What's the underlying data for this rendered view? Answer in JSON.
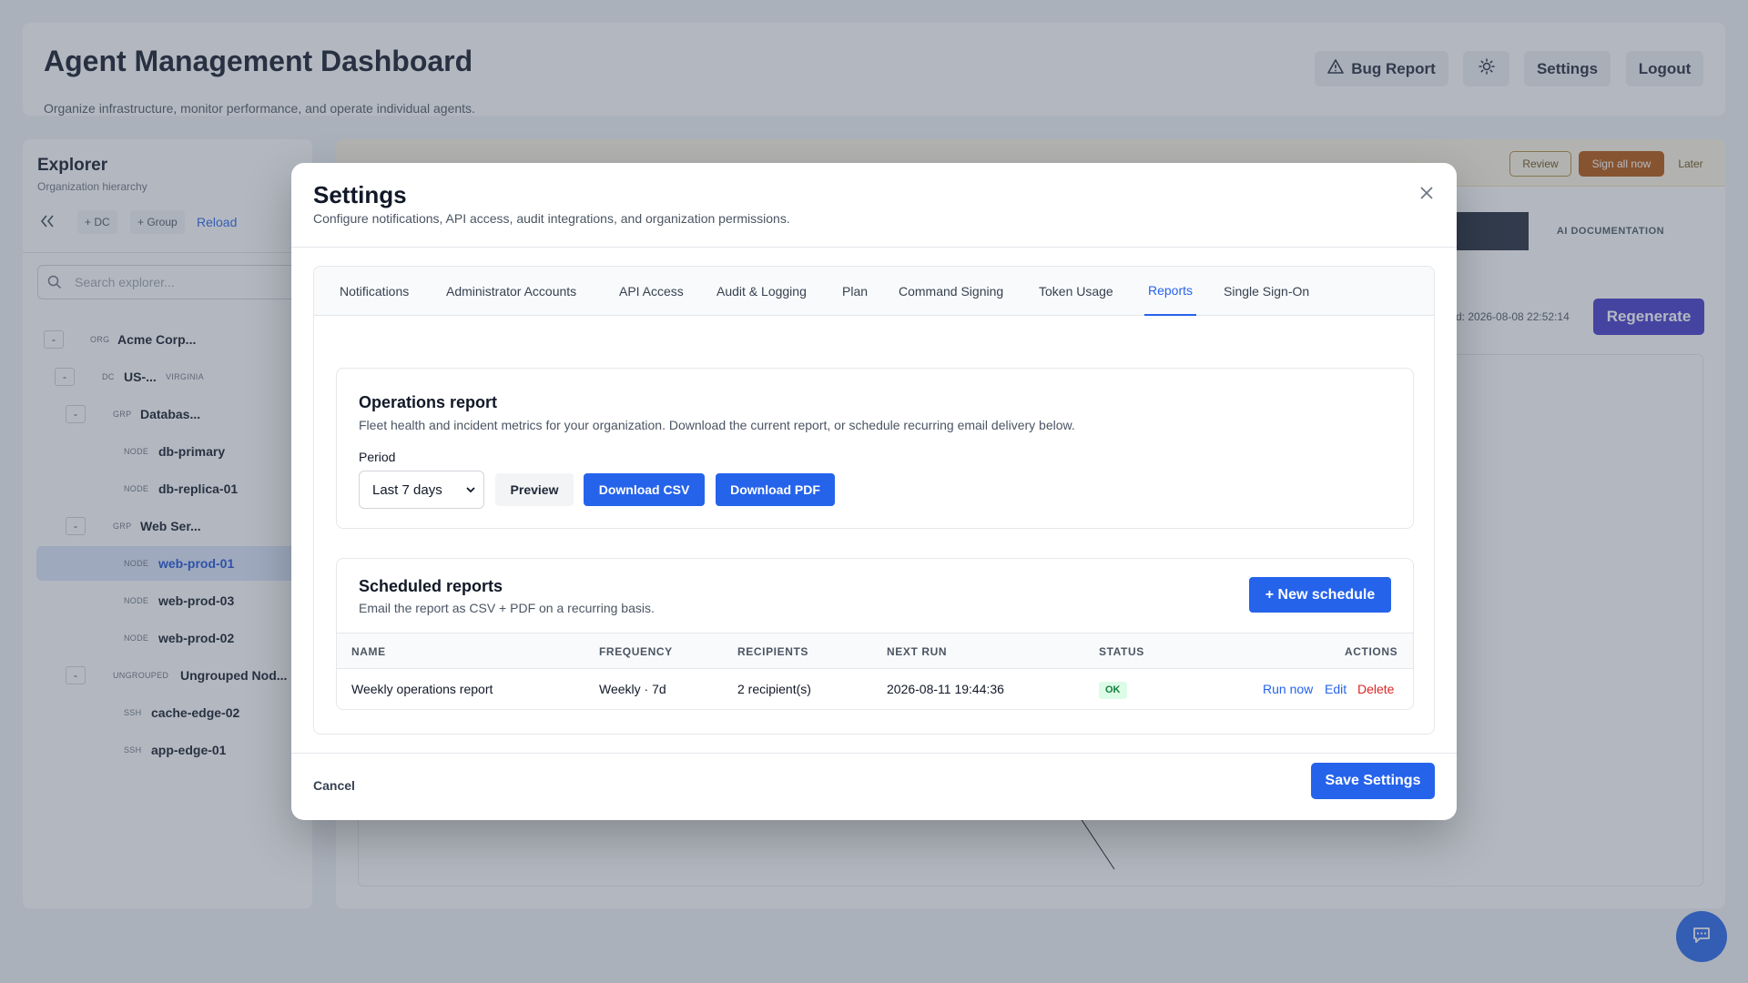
{
  "app": {
    "title": "Agent Management Dashboard",
    "subtitle": "Organize infrastructure, monitor performance, and operate individual agents.",
    "header_buttons": {
      "bug_report": "Bug Report",
      "settings": "Settings",
      "logout": "Logout"
    }
  },
  "explorer": {
    "title": "Explorer",
    "subtitle": "Organization hierarchy",
    "tools": {
      "add_dc": "+ DC",
      "add_group": "+ Group",
      "reload": "Reload"
    },
    "search_placeholder": "Search explorer...",
    "tree": [
      {
        "toggle": "-",
        "type": "ORG",
        "name": "Acme Corp..."
      },
      {
        "toggle": "-",
        "type": "DC",
        "name": "US-...",
        "extra": "VIRGINIA"
      },
      {
        "toggle": "-",
        "type": "GRP",
        "name": "Databas..."
      },
      {
        "type": "NODE",
        "name": "db-primary"
      },
      {
        "type": "NODE",
        "name": "db-replica-01"
      },
      {
        "toggle": "-",
        "type": "GRP",
        "name": "Web Ser..."
      },
      {
        "type": "NODE",
        "name": "web-prod-01",
        "selected": true
      },
      {
        "type": "NODE",
        "name": "web-prod-03"
      },
      {
        "type": "NODE",
        "name": "web-prod-02"
      },
      {
        "toggle": "-",
        "type": "UNGROUPED",
        "name": "Ungrouped Nod..."
      },
      {
        "type": "SSH",
        "name": "cache-edge-02"
      },
      {
        "type": "SSH",
        "name": "app-edge-01"
      }
    ]
  },
  "main": {
    "banner_buttons": {
      "review": "Review",
      "sign_all": "Sign all now",
      "later": "Later"
    },
    "ai_tab": "AI DOCUMENTATION",
    "generated_meta": "d: 2026-08-08 22:52:14",
    "regenerate": "Regenerate"
  },
  "modal": {
    "title": "Settings",
    "subtitle": "Configure notifications, API access, audit integrations, and organization permissions.",
    "tabs": [
      {
        "label": "Notifications"
      },
      {
        "label": "Administrator Accounts"
      },
      {
        "label": "API Access"
      },
      {
        "label": "Audit & Logging"
      },
      {
        "label": "Plan"
      },
      {
        "label": "Command Signing"
      },
      {
        "label": "Token Usage"
      },
      {
        "label": "Reports",
        "active": true
      },
      {
        "label": "Single Sign-On"
      }
    ],
    "operations": {
      "title": "Operations report",
      "desc": "Fleet health and incident metrics for your organization. Download the current report, or schedule recurring email delivery below.",
      "period_label": "Period",
      "period_value": "Last 7 days",
      "preview": "Preview",
      "download_csv": "Download CSV",
      "download_pdf": "Download PDF"
    },
    "scheduled": {
      "title": "Scheduled reports",
      "desc": "Email the report as CSV + PDF on a recurring basis.",
      "new_schedule": "+ New schedule",
      "columns": [
        "NAME",
        "FREQUENCY",
        "RECIPIENTS",
        "NEXT RUN",
        "STATUS",
        "ACTIONS"
      ],
      "rows": [
        {
          "name": "Weekly operations report",
          "frequency": "Weekly · 7d",
          "recipients": "2 recipient(s)",
          "next_run": "2026-08-11 19:44:36",
          "status": "OK",
          "actions": {
            "run_now": "Run now",
            "edit": "Edit",
            "delete": "Delete"
          }
        }
      ]
    },
    "cancel": "Cancel",
    "save": "Save Settings"
  },
  "colors": {
    "accent": "#2563eb",
    "regenerate": "#4338ca",
    "danger": "#dc2626",
    "ok_bg": "#dcfce7",
    "ok_text": "#15803d"
  },
  "icons": [
    "warning-icon",
    "sun-icon",
    "chevrons-left-icon",
    "search-icon",
    "close-icon",
    "chevron-down-icon",
    "chat-icon"
  ]
}
